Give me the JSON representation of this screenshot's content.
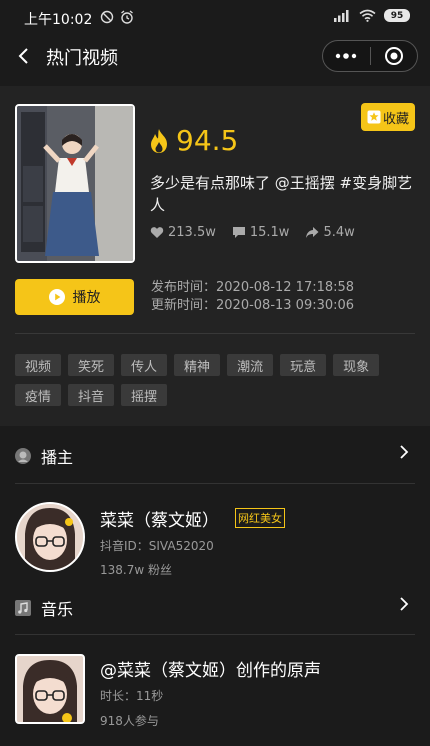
{
  "status_bar": {
    "time": "上午10:02",
    "battery": "95"
  },
  "nav": {
    "title": "热门视频"
  },
  "video": {
    "score": "94.5",
    "favorite_label": "收藏",
    "title": "多少是有点那味了 @王摇摆 #变身脚艺人",
    "likes": "213.5w",
    "comments": "15.1w",
    "shares": "5.4w",
    "play_label": "播放",
    "published": "发布时间：2020-08-12 17:18:58",
    "updated": "更新时间：2020-08-13 09:30:06",
    "tags": [
      "视频",
      "笑死",
      "传人",
      "精神",
      "潮流",
      "玩意",
      "现象",
      "疫情",
      "抖音",
      "摇摆"
    ]
  },
  "host": {
    "section_title": "播主",
    "name": "菜菜（蔡文姬）",
    "badge": "网红美女",
    "account_id": "抖音ID：SIVA52020",
    "followers": "138.7w 粉丝"
  },
  "music": {
    "section_title": "音乐",
    "title": "@菜菜（蔡文姬）创作的原声",
    "duration": "时长：11秒",
    "participants": "918人参与"
  },
  "colors": {
    "accent": "#f5c518",
    "background": "#1b1b1b",
    "card": "#232323"
  }
}
